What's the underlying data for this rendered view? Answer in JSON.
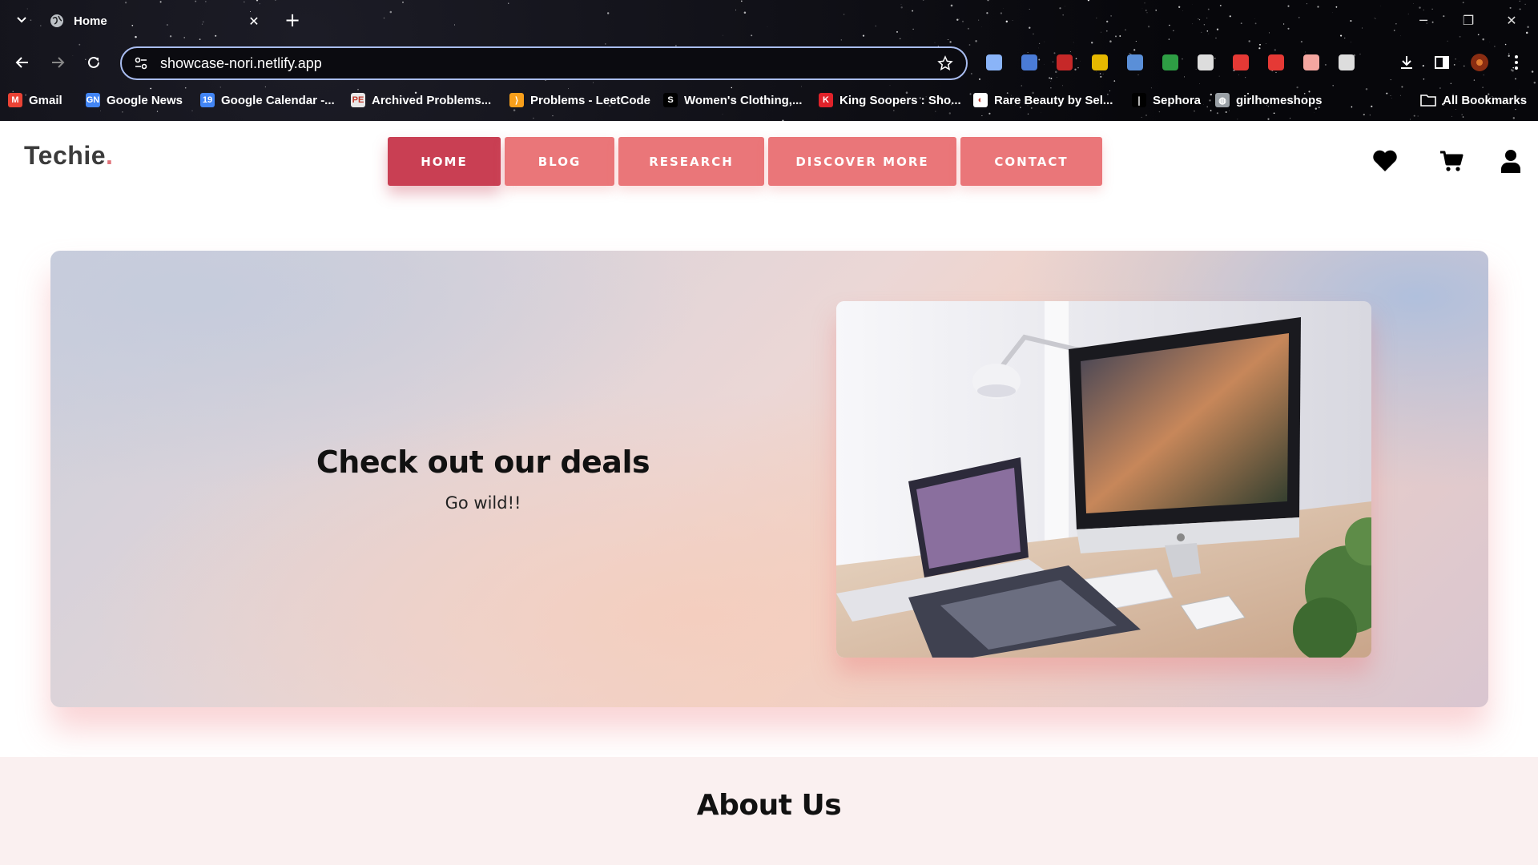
{
  "browser": {
    "tab": {
      "title": "Home",
      "close": "✕"
    },
    "new_tab": "+",
    "window_controls": {
      "minimize": "─",
      "restore": "❐",
      "close": "✕"
    },
    "url": "showcase-nori.netlify.app",
    "bookmarks": [
      {
        "label": "Gmail",
        "icon": "gmail-icon",
        "color": "#ea4335",
        "glyph": "M"
      },
      {
        "label": "Google News",
        "icon": "google-news-icon",
        "color": "#4285f4",
        "glyph": "GN"
      },
      {
        "label": "Google Calendar -...",
        "icon": "google-calendar-icon",
        "color": "#4285f4",
        "glyph": "19"
      },
      {
        "label": "Archived Problems...",
        "icon": "project-euler-icon",
        "color": "#e8e8e8",
        "glyph": "PE"
      },
      {
        "label": "Problems - LeetCode",
        "icon": "leetcode-icon",
        "color": "#f89f1b",
        "glyph": "⟩"
      },
      {
        "label": "Women's Clothing,...",
        "icon": "shein-icon",
        "color": "#000000",
        "glyph": "S"
      },
      {
        "label": "King Soopers : Sho...",
        "icon": "king-soopers-icon",
        "color": "#e0222a",
        "glyph": "K"
      },
      {
        "label": "Rare Beauty by Sel...",
        "icon": "rare-beauty-icon",
        "color": "#ffffff",
        "glyph": "◐"
      },
      {
        "label": "Sephora",
        "icon": "sephora-icon",
        "color": "#000000",
        "glyph": "❘"
      },
      {
        "label": "girlhomeshops",
        "icon": "globe-icon",
        "color": "#9aa0a6",
        "glyph": "◍"
      }
    ],
    "all_bookmarks": "All Bookmarks",
    "extension_colors": [
      "#8ab4f8",
      "#4a7bd6",
      "#c62828",
      "#e6b800",
      "#5a8fd8",
      "#2e9e44",
      "#dddddd",
      "#e53935",
      "#e53935",
      "#f4a6a0",
      "#dddddd"
    ]
  },
  "site": {
    "logo": "Techie",
    "logo_dot": ".",
    "nav": [
      "HOME",
      "BLOG",
      "RESEARCH",
      "DISCOVER MORE",
      "CONTACT"
    ],
    "active_nav": "HOME",
    "accent": "#ea7679",
    "accent_active": "#c93f53",
    "icons": [
      "heart-icon",
      "cart-icon",
      "user-icon"
    ]
  },
  "hero": {
    "title": "Check out our deals",
    "subtitle": "Go wild!!"
  },
  "about": {
    "title": "About Us"
  }
}
